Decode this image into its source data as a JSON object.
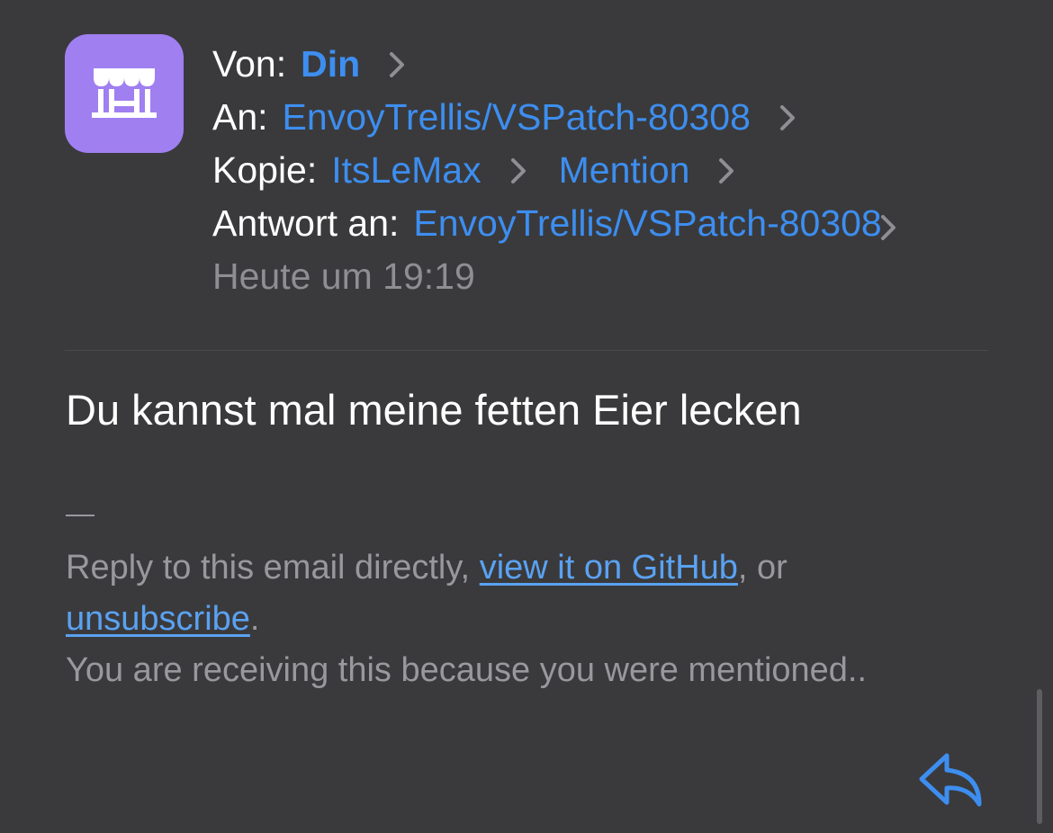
{
  "sender": {
    "avatar_icon": "storefront-icon",
    "avatar_color": "#a07ff0"
  },
  "header": {
    "from_label": "Von:",
    "from_value": "Din",
    "to_label": "An:",
    "to_value": "EnvoyTrellis/VSPatch-80308",
    "cc_label": "Kopie:",
    "cc_values": [
      "ItsLeMax",
      "Mention"
    ],
    "reply_to_label": "Antwort an:",
    "reply_to_value": "EnvoyTrellis/VSPatch-80308",
    "timestamp": "Heute um 19:19"
  },
  "message": {
    "body": "Du kannst mal meine fetten Eier lecken"
  },
  "footer": {
    "reply_text": "Reply to this email directly,",
    "github_link": "view it on GitHub",
    "or_text": ", or",
    "unsubscribe_link": "unsubscribe",
    "period": ".",
    "reason_text": "You are receiving this because you were mentioned.."
  },
  "colors": {
    "background": "#3a3a3c",
    "accent": "#3d8ef0",
    "secondary_text": "#98989d"
  },
  "actions": {
    "reply_icon": "reply-arrow-icon"
  }
}
